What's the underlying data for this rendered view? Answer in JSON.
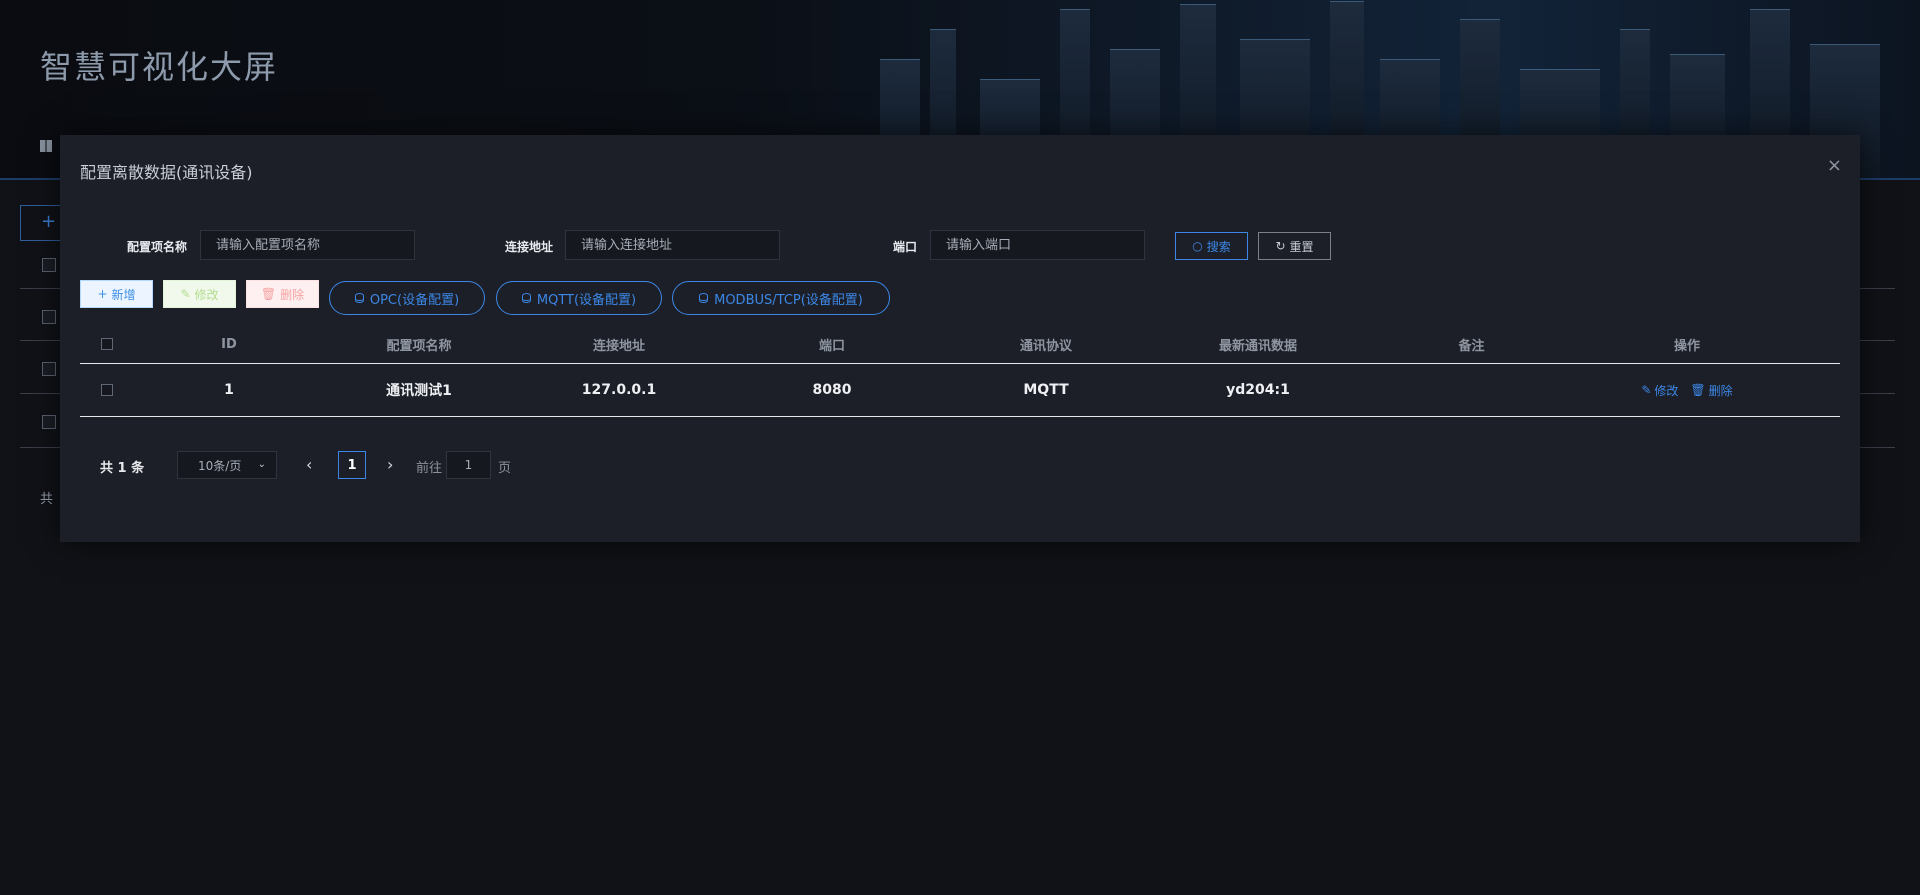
{
  "app": {
    "title": "智慧可视化大屏"
  },
  "modal": {
    "title": "配置离散数据(通讯设备)",
    "close_icon": "×"
  },
  "filters": {
    "name_label": "配置项名称",
    "name_placeholder": "请输入配置项名称",
    "address_label": "连接地址",
    "address_placeholder": "请输入连接地址",
    "port_label": "端口",
    "port_placeholder": "请输入端口",
    "search_label": "搜索",
    "reset_label": "重置"
  },
  "toolbar": {
    "add_label": "新增",
    "edit_label": "修改",
    "delete_label": "删除",
    "opc_label": "OPC(设备配置)",
    "mqtt_label": "MQTT(设备配置)",
    "modbus_label": "MODBUS/TCP(设备配置)"
  },
  "table": {
    "columns": [
      "ID",
      "配置项名称",
      "连接地址",
      "端口",
      "通讯协议",
      "最新通讯数据",
      "备注",
      "操作"
    ],
    "rows": [
      {
        "id": "1",
        "name": "通讯测试1",
        "address": "127.0.0.1",
        "port": "8080",
        "protocol": "MQTT",
        "latest": "yd204:1",
        "remark": "",
        "edit": "修改",
        "delete": "删除"
      }
    ]
  },
  "pagination": {
    "total": "共 1 条",
    "page_size": "10条/页",
    "current_page": "1",
    "goto_label": "前往",
    "goto_value": "1",
    "page_suffix": "页"
  },
  "background": {
    "footer_total": "共"
  },
  "colors": {
    "accent": "#3c87e6",
    "modal_bg": "#1c1f27",
    "page_bg": "#101217"
  }
}
